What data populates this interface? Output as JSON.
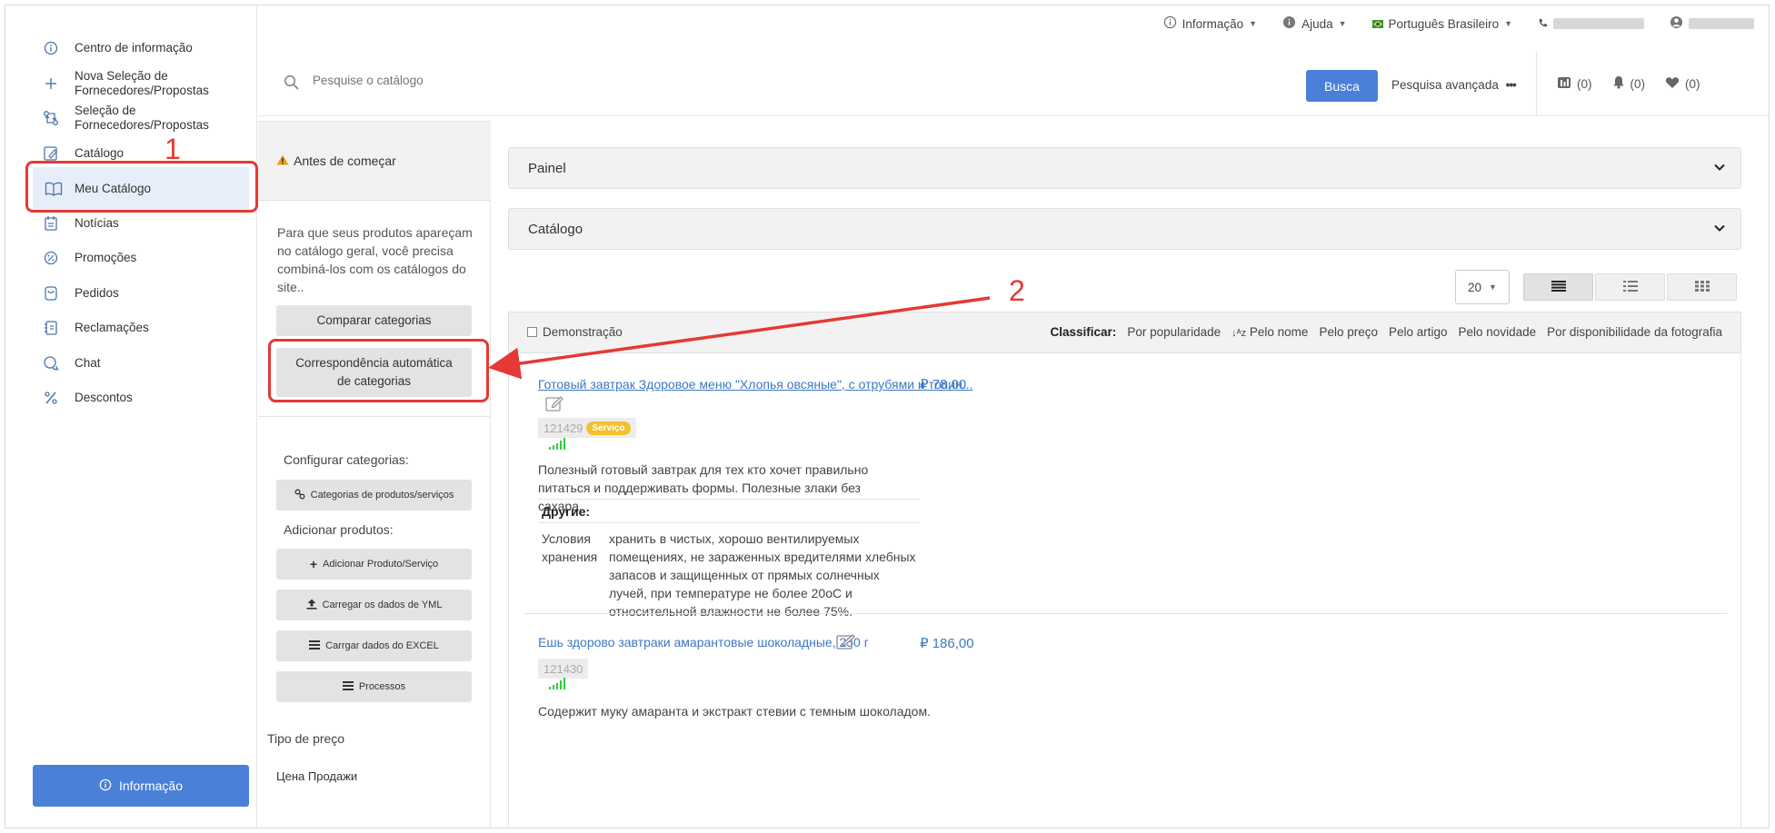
{
  "sidebar": {
    "items": [
      {
        "label": "Centro de informação",
        "icon": "info-icon"
      },
      {
        "label": "Nova Seleção de Fornecedores/Propostas",
        "icon": "plus-icon"
      },
      {
        "label": "Seleção de Fornecedores/Propostas",
        "icon": "exchange-icon"
      },
      {
        "label": "Catálogo",
        "icon": "catalog-icon"
      },
      {
        "label": "Meu Catálogo",
        "icon": "book-icon"
      },
      {
        "label": "Notícias",
        "icon": "news-icon"
      },
      {
        "label": "Promoções",
        "icon": "percent-circle-icon"
      },
      {
        "label": "Pedidos",
        "icon": "cart-icon"
      },
      {
        "label": "Reclamações",
        "icon": "complaint-icon"
      },
      {
        "label": "Chat",
        "icon": "chat-icon"
      },
      {
        "label": "Descontos",
        "icon": "percent-icon"
      }
    ],
    "info_button": "Informação"
  },
  "annotations": {
    "one": "1",
    "two": "2",
    "color": "#e53935"
  },
  "topbar": {
    "info": "Informação",
    "help": "Ajuda",
    "language": "Português Brasileiro"
  },
  "search": {
    "placeholder": "Pesquise o catálogo",
    "button": "Busca",
    "advanced": "Pesquisa avançada",
    "compare_count": "(0)",
    "notify_count": "(0)",
    "fav_count": "(0)"
  },
  "panel": {
    "before_title": "Antes de começar",
    "intro_text": "Para que seus produtos apareçam no catálogo geral, você precisa combiná-los com os catálogos do site..",
    "compare_button": "Comparar categorias",
    "auto_match_button": "Correspondência automática de categorias",
    "configure_label": "Configurar categorias:",
    "categories_button": "Categorias de produtos/serviços",
    "add_label": "Adicionar produtos:",
    "add_product_button": "Adicionar Produto/Serviço",
    "yml_button": "Carregar os dados de YML",
    "excel_button": "Carrgar dados do EXCEL",
    "process_button": "Processos",
    "price_type_label": "Tipo de preço",
    "price_type_value": "Цена Продажи"
  },
  "main": {
    "accordion_painel": "Painel",
    "accordion_catalogo": "Catálogo",
    "per_page": "20",
    "demo_label": "Demonstração",
    "sort_label": "Classificar:",
    "sort_options": [
      "Por popularidade",
      "Pelo nome",
      "Pelo preço",
      "Pelo artigo",
      "Pelo novidade",
      "Por disponibilidade da fotografia"
    ],
    "products": [
      {
        "title": "Готовый завтрак Здоровое меню \"Хлопья овсяные\", с отрубями и топин...",
        "price": "₽ 78,00",
        "sku": "121429",
        "badge": "Serviço",
        "description": "Полезный готовый завтрак для тех кто хочет правильно питаться и поддерживать формы. Полезные злаки без сахара.",
        "other_title": "Другие:",
        "attr_name": "Условия хранения",
        "attr_value": "хранить в чистых, хорошо вентилируемых помещениях, не зараженных вредителями хлебных запасов и защищенных от прямых солнечных лучей, при температуре не более 20оС и относительной влажности не более 75%."
      },
      {
        "title": "Ешь здорово завтраки амарантовые шоколадные, 250 г",
        "price": "₽ 186,00",
        "sku": "121430",
        "description": "Содержит муку амаранта и экстракт стевии с темным шоколадом."
      }
    ]
  }
}
